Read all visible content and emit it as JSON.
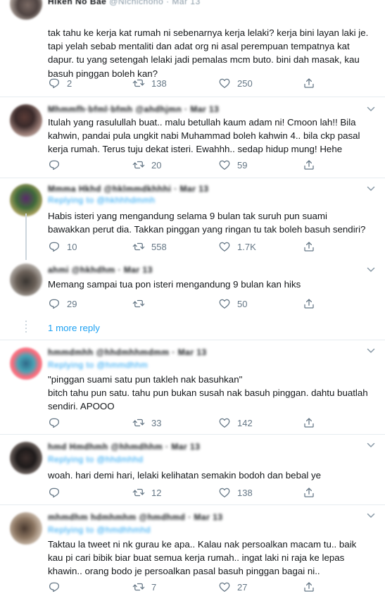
{
  "tweets": [
    {
      "top_name": "Hikeh No Bae",
      "top_handle": "@Nichichono · Mar 13",
      "text": "tak tahu ke kerja kat rumah ni sebenarnya kerja lelaki? kerja bini layan laki je. tapi yelah sebab mentaliti dan adat org ni asal perempuan tempatnya kat dapur. tu yang setengah lelaki jadi pemalas mcm buto. bini dah masak, kau basuh pinggan boleh kan?",
      "replies": "2",
      "retweets": "138",
      "likes": "250"
    },
    {
      "name_blur": "Mhmmfh·bfml·bfmh  @ahdhjmn · Mar 13",
      "text": "Itulah yang rasulullah buat.. malu betullah kaum adam ni! Cmoon lah!! Bila kahwin, pandai pula ungkit nabi Muhammad boleh kahwin 4.. bila ckp pasal kerja rumah. Terus tuju dekat isteri. Ewahhh.. sedap hidup mung! Hehe",
      "replies": "",
      "retweets": "20",
      "likes": "59"
    },
    {
      "name_blur": "Mmma  Hkhd  @hklmmdkhhhi · Mar 13",
      "reply_to": "Replying to @hkhhhdmmh",
      "text": "Habis isteri yang mengandung selama 9 bulan tak suruh pun suami bawakkan perut dia. Takkan pinggan yang ringan tu tak boleh basuh sendiri?",
      "replies": "10",
      "retweets": "558",
      "likes": "1.7K"
    },
    {
      "name_blur": "ahmi @hkhdhm · Mar 13",
      "text": "Memang sampai tua pon isteri mengandung 9 bulan kan hiks",
      "replies": "29",
      "retweets": "",
      "likes": "50"
    },
    {
      "name_blur": "hmmdmhh  @hhdmhhmdmm · Mar 13",
      "reply_to": "Replying to @hmmdhhm",
      "text": "\"pinggan suami satu pun takleh nak basuhkan\"\nbitch tahu pun satu. tahu pun bukan susah nak basuh pinggan. dahtu buatlah sendiri. APOOO",
      "replies": "",
      "retweets": "33",
      "likes": "142"
    },
    {
      "name_blur": "hmd  Hmdhmh  @hhmdhhm · Mar 13",
      "reply_to": "Replying to @hhdmhhd",
      "text": "woah. hari demi hari, lelaki kelihatan semakin bodoh dan bebal ye",
      "replies": "",
      "retweets": "12",
      "likes": "138"
    },
    {
      "name_blur": "mhmdhm  hdmhmhm  @hmdhmd · Mar 13",
      "reply_to": "Replying to @hmdhhmhd",
      "text": "Taktau la tweet ni nk gurau ke apa.. Kalau nak persoalkan macam tu.. baik kau pi cari bibik biar buat semua kerja rumah.. ingat laki ni raja ke lepas khawin.. orang bodo je persoalkan pasal basuh pinggan bagai ni..",
      "replies": "",
      "retweets": "7",
      "likes": "27"
    }
  ],
  "more_reply": "1 more reply",
  "colors": {
    "accent": "#1da1f2",
    "muted": "#657786",
    "separator": "#e6ecf0"
  },
  "icons": [
    "reply-icon",
    "retweet-icon",
    "like-icon",
    "share-icon",
    "chevron-down-icon"
  ]
}
